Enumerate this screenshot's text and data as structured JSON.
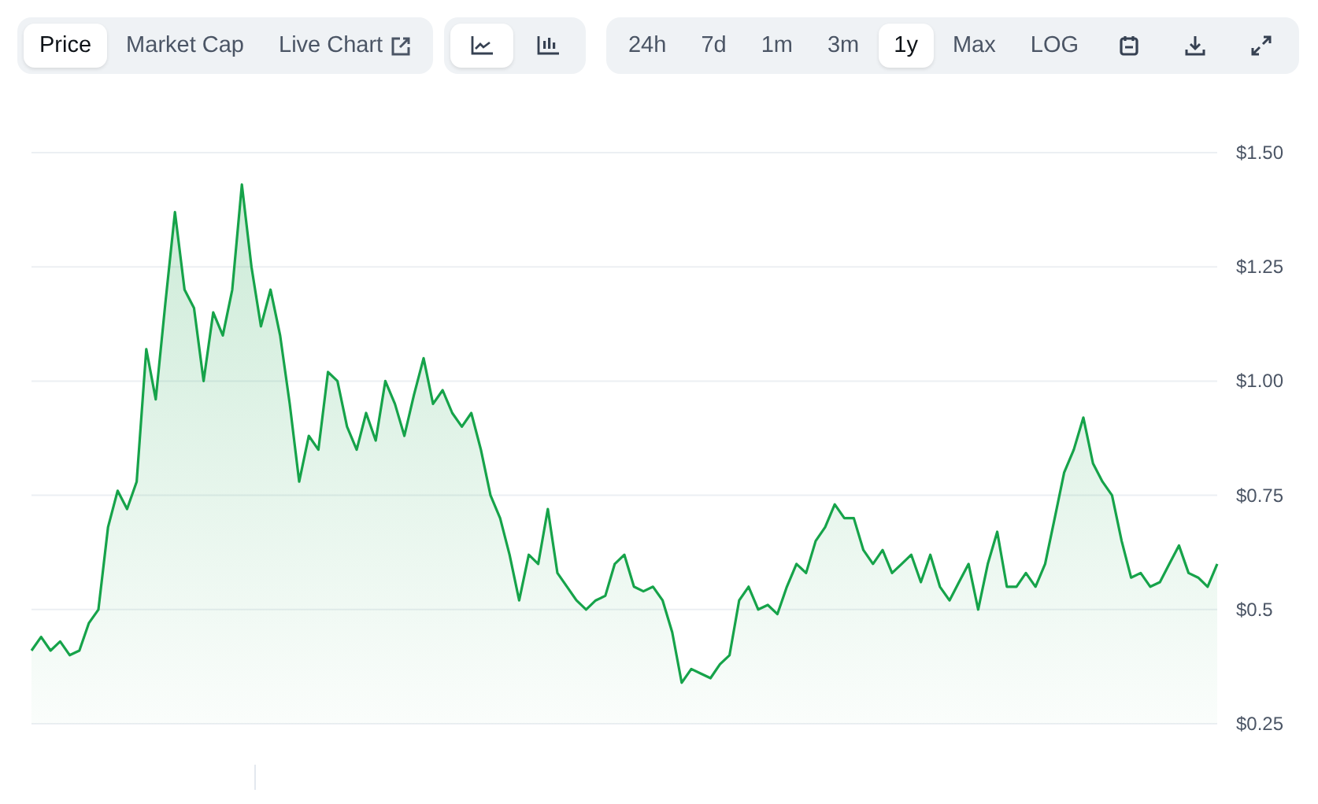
{
  "tabs": [
    {
      "label": "Price",
      "selected": true,
      "external": false
    },
    {
      "label": "Market Cap",
      "selected": false,
      "external": false
    },
    {
      "label": "Live Chart",
      "selected": false,
      "external": true
    }
  ],
  "chart_types": [
    {
      "kind": "line",
      "selected": true
    },
    {
      "kind": "candlestick",
      "selected": false
    }
  ],
  "ranges": [
    {
      "label": "24h",
      "selected": false
    },
    {
      "label": "7d",
      "selected": false
    },
    {
      "label": "1m",
      "selected": false
    },
    {
      "label": "3m",
      "selected": false
    },
    {
      "label": "1y",
      "selected": true
    },
    {
      "label": "Max",
      "selected": false
    }
  ],
  "scale": {
    "label": "LOG",
    "selected": false
  },
  "chart_data": {
    "type": "area",
    "grid": true,
    "ylim": [
      0.25,
      1.5
    ],
    "yticks": [
      {
        "value": 0.25,
        "label": "$0.25"
      },
      {
        "value": 0.5,
        "label": "$0.5"
      },
      {
        "value": 0.75,
        "label": "$0.75"
      },
      {
        "value": 1,
        "label": "$1.00"
      },
      {
        "value": 1.25,
        "label": "$1.25"
      },
      {
        "value": 1.5,
        "label": "$1.50"
      }
    ],
    "series": [
      {
        "color": "#16a34a",
        "values": [
          0.41,
          0.44,
          0.41,
          0.43,
          0.4,
          0.41,
          0.47,
          0.5,
          0.68,
          0.76,
          0.72,
          0.78,
          1.07,
          0.96,
          1.17,
          1.37,
          1.2,
          1.16,
          1.0,
          1.15,
          1.1,
          1.2,
          1.43,
          1.25,
          1.12,
          1.2,
          1.1,
          0.95,
          0.78,
          0.88,
          0.85,
          1.02,
          1.0,
          0.9,
          0.85,
          0.93,
          0.87,
          1.0,
          0.95,
          0.88,
          0.97,
          1.05,
          0.95,
          0.98,
          0.93,
          0.9,
          0.93,
          0.85,
          0.75,
          0.7,
          0.62,
          0.52,
          0.62,
          0.6,
          0.72,
          0.58,
          0.55,
          0.52,
          0.5,
          0.52,
          0.53,
          0.6,
          0.62,
          0.55,
          0.54,
          0.55,
          0.52,
          0.45,
          0.34,
          0.37,
          0.36,
          0.35,
          0.38,
          0.4,
          0.52,
          0.55,
          0.5,
          0.51,
          0.49,
          0.55,
          0.6,
          0.58,
          0.65,
          0.68,
          0.73,
          0.7,
          0.7,
          0.63,
          0.6,
          0.63,
          0.58,
          0.6,
          0.62,
          0.56,
          0.62,
          0.55,
          0.52,
          0.56,
          0.6,
          0.5,
          0.6,
          0.67,
          0.55,
          0.55,
          0.58,
          0.55,
          0.6,
          0.7,
          0.8,
          0.85,
          0.92,
          0.82,
          0.78,
          0.75,
          0.65,
          0.57,
          0.58,
          0.55,
          0.56,
          0.6,
          0.64,
          0.58,
          0.57,
          0.55,
          0.6
        ]
      }
    ]
  }
}
